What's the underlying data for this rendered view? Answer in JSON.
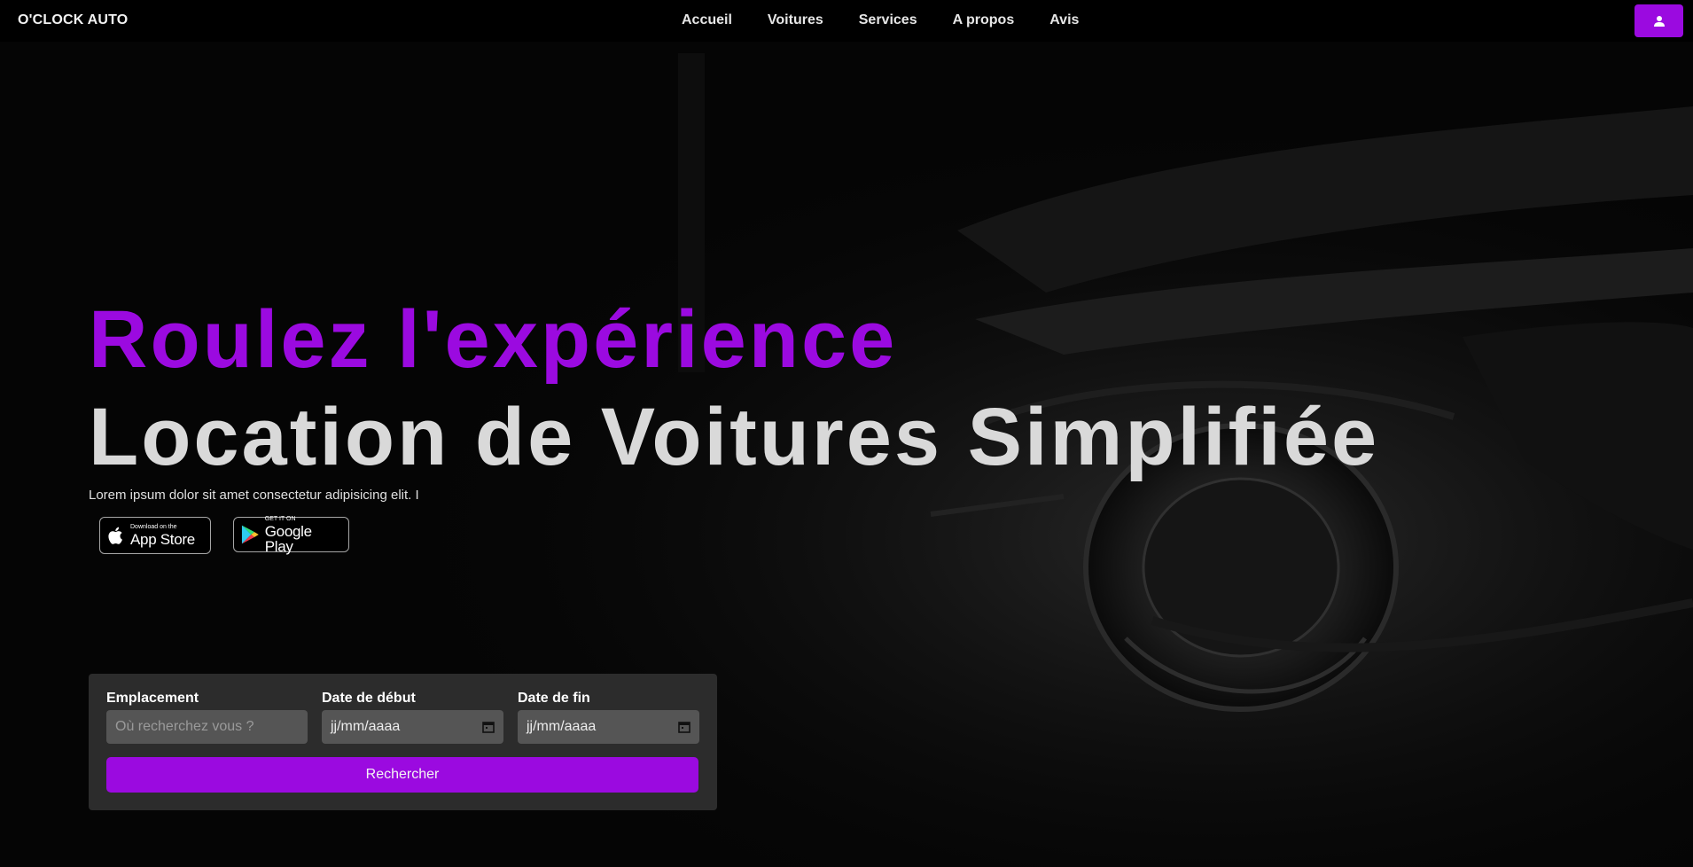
{
  "navbar": {
    "brand": "O'CLOCK AUTO",
    "links": [
      "Accueil",
      "Voitures",
      "Services",
      "A propos",
      "Avis"
    ],
    "user_button_icon": "user-icon"
  },
  "hero": {
    "title_line1": "Roulez l'expérience",
    "title_line2": "Location de Voitures Simplifiée",
    "subtitle": "Lorem ipsum dolor sit amet consectetur adipisicing elit. I",
    "app_store": {
      "small": "Download on the",
      "big": "App Store",
      "icon": "apple-icon"
    },
    "google_play": {
      "small": "GET IT ON",
      "big": "Google Play",
      "icon": "google-play-icon"
    }
  },
  "search": {
    "location_label": "Emplacement",
    "location_placeholder": "Où recherchez vous ?",
    "start_label": "Date de début",
    "start_value": "jj/mm/aaaa",
    "end_label": "Date de fin",
    "end_value": "jj/mm/aaaa",
    "button_label": "Rechercher"
  },
  "colors": {
    "accent": "#9b0ae0",
    "background": "#050505",
    "panel": "#2c2c2c",
    "input": "#555555"
  }
}
